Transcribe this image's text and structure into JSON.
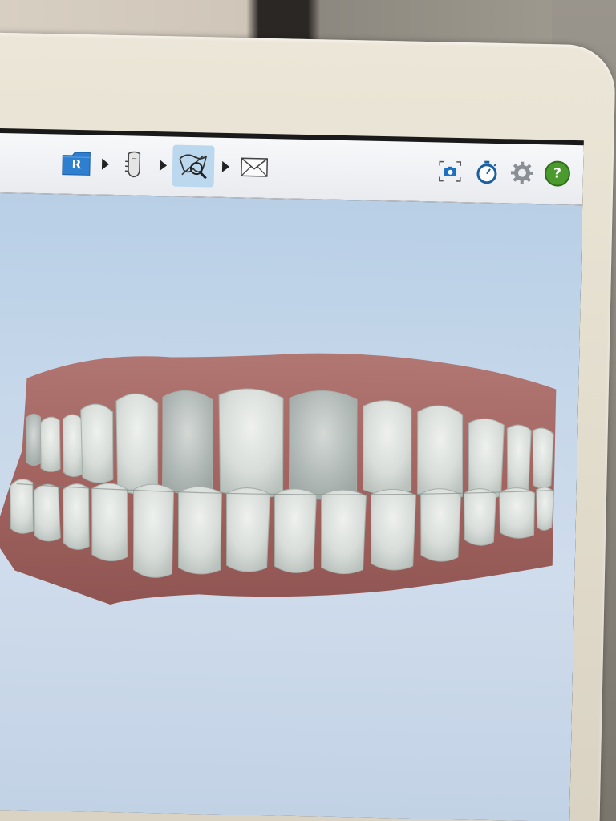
{
  "toolbar": {
    "steps": [
      {
        "icon": "patient-folder-icon",
        "label": "R",
        "active": false
      },
      {
        "icon": "scan-tooth-icon",
        "active": false
      },
      {
        "icon": "view-analyze-icon",
        "active": true
      },
      {
        "icon": "send-envelope-icon",
        "active": false
      }
    ],
    "right_tools": [
      {
        "icon": "camera-snapshot-icon"
      },
      {
        "icon": "stopwatch-icon"
      },
      {
        "icon": "gear-icon"
      },
      {
        "icon": "help-icon",
        "label": "?"
      }
    ]
  },
  "colors": {
    "folder_blue": "#2f7fd0",
    "help_green": "#4a9a2e",
    "viewport_bg": "#c5d7ea",
    "gum": "#a56a66",
    "tooth": "#dfe3e0"
  }
}
